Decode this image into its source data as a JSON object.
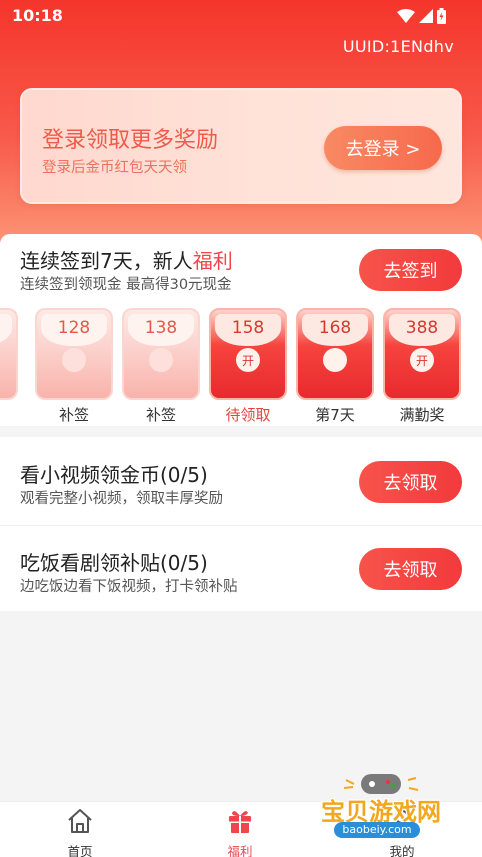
{
  "status_bar": {
    "time": "10:18"
  },
  "uuid": "UUID:1ENdhv",
  "login_card": {
    "title": "登录领取更多奖励",
    "subtitle": "登录后金币红包天天领",
    "button": "去登录 >"
  },
  "signin": {
    "title_main": "连续签到7天，新人",
    "title_highlight": "福利",
    "subtitle": "连续签到领现金 最高得30元现金",
    "button": "去签到",
    "packets": [
      {
        "amount": "128",
        "label": "补签",
        "seal": "",
        "state": "light"
      },
      {
        "amount": "138",
        "label": "补签",
        "seal": "",
        "state": "light"
      },
      {
        "amount": "158",
        "label": "待领取",
        "seal": "开",
        "state": "dark"
      },
      {
        "amount": "168",
        "label": "第7天",
        "seal": "",
        "state": "dark"
      },
      {
        "amount": "388",
        "label": "满勤奖",
        "seal": "开",
        "state": "dark"
      }
    ]
  },
  "tasks": [
    {
      "title": "看小视频领金币(0/5)",
      "subtitle": "观看完整小视频，领取丰厚奖励",
      "button": "去领取"
    },
    {
      "title": "吃饭看剧领补贴(0/5)",
      "subtitle": "边吃饭边看下饭视频，打卡领补贴",
      "button": "去领取"
    }
  ],
  "bottom_nav": [
    {
      "label": "首页",
      "icon": "home-icon",
      "active": false
    },
    {
      "label": "福利",
      "icon": "gift-icon",
      "active": true
    },
    {
      "label": "我的",
      "icon": "user-icon",
      "active": false
    }
  ],
  "watermark": {
    "text": "宝贝游戏网",
    "url": "baobeiy.com"
  },
  "colors": {
    "accent": "#f23a3c",
    "header": "#f5352c",
    "active_nav": "#f0454d"
  }
}
